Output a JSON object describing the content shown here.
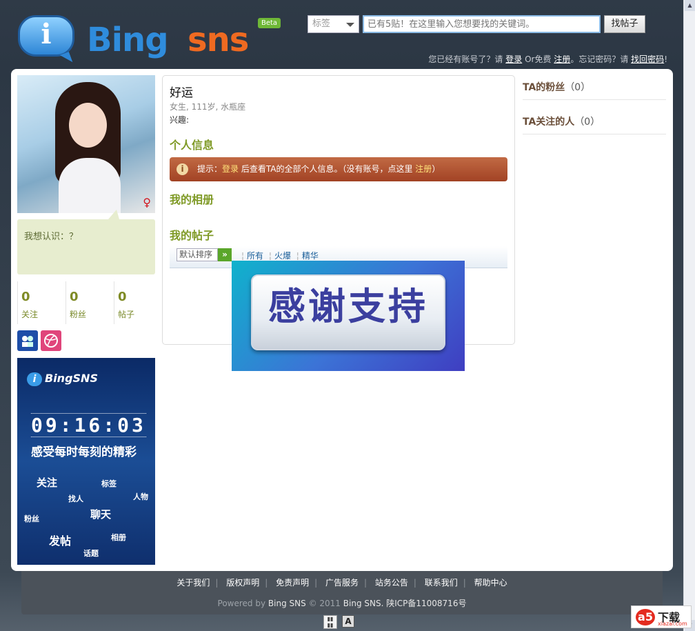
{
  "header": {
    "logo_i": "i",
    "logo_bing": "Bing",
    "logo_sns": "sns",
    "beta": "Beta",
    "search": {
      "category": "标签",
      "placeholder": "已有5贴！在这里输入您想要找的关键词。",
      "button": "找帖子"
    },
    "login": {
      "prefix": "您已经有账号了？请",
      "login_link": "登录",
      "mid": "Or免费",
      "register_link": "注册",
      "forgot": "。忘记密码？请",
      "recover_link": "找回密码",
      "suffix": "!"
    }
  },
  "profile": {
    "name": "好运",
    "meta": "女生, 111岁, 水瓶座",
    "interests": "兴趣:",
    "want_to_meet": "我想认识：？",
    "stats": [
      {
        "value": "0",
        "label": "关注"
      },
      {
        "value": "0",
        "label": "粉丝"
      },
      {
        "value": "0",
        "label": "帖子"
      }
    ],
    "sections": {
      "info": "个人信息",
      "album": "我的相册",
      "posts": "我的帖子"
    },
    "tip": {
      "prefix": "提示：",
      "login": "登录",
      "mid": "后查看TA的全部个人信息。（没有账号，点这里",
      "register": "注册",
      "suffix": "）"
    },
    "sort": {
      "selected": "默认排序",
      "go": "»",
      "links": [
        "所有",
        "火爆",
        "精华"
      ]
    }
  },
  "popup": {
    "text": "感谢支持"
  },
  "banner": {
    "logo": "BingSNS",
    "time": "09:16:03",
    "slogan": "感受每时每刻的精彩",
    "words": [
      "关注",
      "标签",
      "找人",
      "人物",
      "粉丝",
      "聊天",
      "发帖",
      "相册",
      "话题"
    ]
  },
  "sidebar": {
    "fans": {
      "label": "TA的粉丝",
      "count": "（0）"
    },
    "following": {
      "label": "TA关注的人",
      "count": "（0）"
    }
  },
  "footer": {
    "links": [
      "关于我们",
      "版权声明",
      "免责声明",
      "广告服务",
      "站务公告",
      "联系我们",
      "帮助中心"
    ],
    "powered": "Powered by",
    "brand": "Bing SNS",
    "copy": "© 2011",
    "brand2": "Bing SNS",
    "icp": ". 陕ICP备11008716号"
  },
  "watermark": {
    "logo": "a5",
    "title": "下载",
    "site": "xiazai.com"
  },
  "colors": {
    "accent_green": "#7f9a26",
    "tip_bar": "#a24224",
    "link_blue": "#1a5e99"
  }
}
